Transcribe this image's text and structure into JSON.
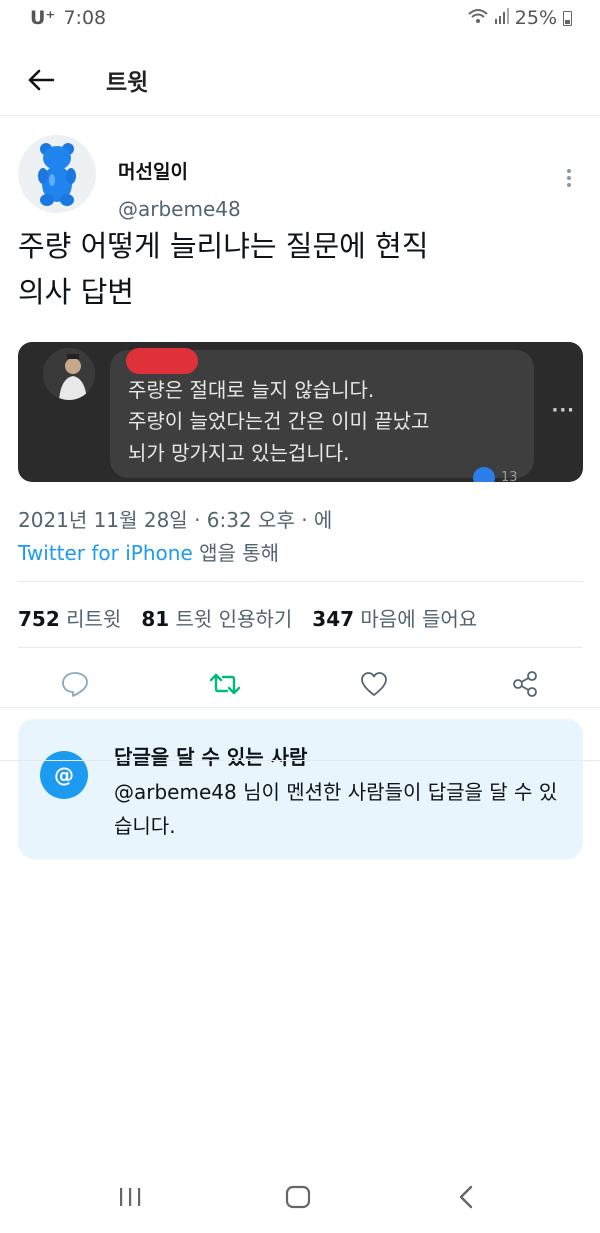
{
  "status_bar": {
    "carrier": "U⁺",
    "time": "7:08",
    "battery": "25%"
  },
  "header": {
    "title": "트윗"
  },
  "tweet": {
    "author_name": "머선일이",
    "author_handle": "@arbeme48",
    "text_line1": "주량 어떻게 늘리냐는 질문에 현직",
    "text_line2": "의사 답변",
    "media": {
      "line1": "주량은 절대로 늘지 않습니다.",
      "line2": "주량이 늘었다는건 간은 이미 끝났고",
      "line3": "뇌가 망가지고 있는겁니다.",
      "more": "···",
      "reaction_count": "13"
    },
    "timestamp": "2021년 11월 28일 · 6:32 오후 · 에",
    "via_app": "Twitter for iPhone",
    "via_suffix": " 앱을 통해"
  },
  "stats": {
    "retweets_count": "752",
    "retweets_label": " 리트윗",
    "quotes_count": "81",
    "quotes_label": " 트윗 인용하기",
    "likes_count": "347",
    "likes_label": " 마음에 들어요"
  },
  "reply_card": {
    "icon": "@",
    "title": "답글을 달 수 있는 사람",
    "description": "@arbeme48 님이 멘션한 사람들이 답글을 달 수 있습니다."
  },
  "colors": {
    "accent": "#1d9bf0",
    "retweet": "#00ba7c",
    "muted": "#536471",
    "card_bg": "#e8f5fd"
  },
  "icons": [
    "back-arrow-icon",
    "more-vertical-icon",
    "reply-icon",
    "retweet-icon",
    "like-icon",
    "share-icon",
    "at-icon",
    "recent-apps-icon",
    "home-icon",
    "nav-back-icon",
    "wifi-icon",
    "signal-icon",
    "battery-icon"
  ]
}
